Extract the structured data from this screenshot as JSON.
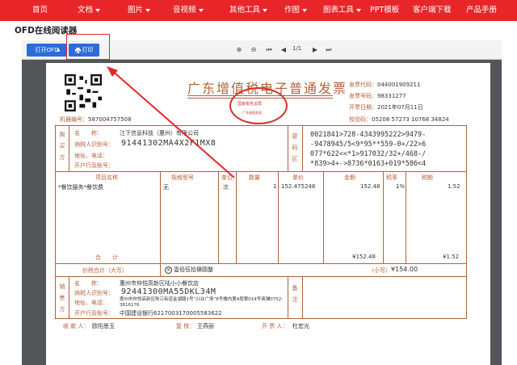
{
  "nav": {
    "items": [
      {
        "label": "首页",
        "has_caret": false
      },
      {
        "label": "文档",
        "has_caret": true
      },
      {
        "label": "图片",
        "has_caret": true
      },
      {
        "label": "音视频",
        "has_caret": true
      },
      {
        "label": "其他工具",
        "has_caret": true
      },
      {
        "label": "作图",
        "has_caret": true
      },
      {
        "label": "图表工具",
        "has_caret": true
      },
      {
        "label": "PPT模板",
        "has_caret": false
      },
      {
        "label": "客户端下载",
        "has_caret": false
      },
      {
        "label": "产品手册",
        "has_caret": false
      }
    ],
    "bg_color": "#e8262a"
  },
  "page_title": "OFD在线阅读器",
  "toolbar": {
    "open_label": "打开OFD",
    "print_label": "打印",
    "page_indicator": "1/1",
    "icons": [
      "zoom-in-icon",
      "zoom-out-icon",
      "first-page-icon",
      "prev-page-icon",
      "next-page-icon",
      "last-page-icon"
    ],
    "accent": "#2c6bd9"
  },
  "invoice": {
    "title": "广东增值税电子普通发票",
    "seal_text": "国家税务总局",
    "seal_sub": "广东省税务局",
    "code_label": "发票代码：",
    "code_value": "044001909211",
    "number_label": "发票号码：",
    "number_value": "98331277",
    "date_label": "开票日期：",
    "date_value": "2021年07月11日",
    "check_label": "校验码：",
    "check_value": "05208 57273 10768 34824",
    "machine_label": "机器编号：",
    "machine_value": "587004757508",
    "buyer": {
      "section_label": "购买方",
      "name_label": "名　　称：",
      "name_value": "江下信息科技（惠州）有限公司",
      "tax_label": "纳税人识别号：",
      "tax_value": "91441302MA4X2F1MX8",
      "addr_label": "地址、电话：",
      "bank_label": "开户行及账号："
    },
    "cipher_section_label": "密码区",
    "cipher_lines": [
      "0021841>728-4343995222>9479-",
      "-9478945/5<9*95**559-0+/22>6",
      "077*622<<*1>917032/32+/468-/",
      "*839>4+->8736*0163+019*586<4"
    ],
    "items_header": {
      "name": "项目名称",
      "spec": "规格型号",
      "unit": "单位",
      "qty": "数量",
      "price": "单价",
      "amount": "金额",
      "tax_rate": "税率",
      "tax": "税额"
    },
    "item": {
      "name": "*餐饮服务*餐饮费",
      "spec": "无",
      "unit": "次",
      "qty": "1",
      "price": "152.475248",
      "amount": "152.48",
      "tax_rate": "1%",
      "tax": "1.52"
    },
    "total_label": "合　　计",
    "total_amount": "¥152.48",
    "total_tax": "¥1.52",
    "grand_label": "价税合计（大写）",
    "grand_words": "壹佰伍拾肆圆整",
    "grand_small_label": "（小写）",
    "grand_small_value": "¥154.00",
    "seller": {
      "section_label": "销售方",
      "name_label": "名　　称：",
      "name_value": "惠州市仲恺高新区陆小小餐饮店",
      "tax_label": "纳税人识别号：",
      "tax_value": "92441300MA55DKL34M",
      "addr_label": "地址、电话：",
      "addr_value": "惠州市仲恺高新区陈江街道金湖路1号“兴业广场”8号楼内第4层第014号商铺0752-3816176",
      "bank_label": "开户行及账号：",
      "bank_value": "中国建设银行6217003170005583622"
    },
    "remark_label": "备注",
    "payee_label": "收 款 人：",
    "payee_value": "欧阳思玉",
    "reviewer_label": "复 核：",
    "reviewer_value": "王燕丽",
    "drawer_label": "开 票 人：",
    "drawer_value": "杜宏光"
  }
}
